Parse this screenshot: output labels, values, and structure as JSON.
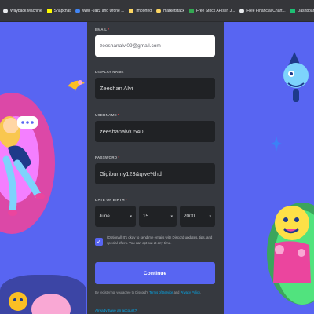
{
  "bookmarks": [
    {
      "label": "Wayback Machine",
      "color": "#e8eaed"
    },
    {
      "label": "Snapchat",
      "color": "#fffc00"
    },
    {
      "label": "Web -Jazz and Ufone ...",
      "color": "#4285f4"
    },
    {
      "label": "Imported",
      "color": "#fdd663"
    },
    {
      "label": "marketstack",
      "color": "#fdd663"
    },
    {
      "label": "Free Stock APIs in J...",
      "color": "#34a853"
    },
    {
      "label": "Free Financial Chart...",
      "color": "#e8eaed"
    },
    {
      "label": "Dashboard | Fiverr K...",
      "color": "#1dbf73"
    }
  ],
  "form": {
    "email": {
      "label": "EMAIL",
      "required": "*",
      "value": "zeeshanalvi09@gmail.com"
    },
    "display_name": {
      "label": "DISPLAY NAME",
      "value": "Zeeshan Alvi"
    },
    "username": {
      "label": "USERNAME",
      "required": "*",
      "value": "zeeshanalvi0540"
    },
    "password": {
      "label": "PASSWORD",
      "required": "*",
      "value": "Gigibunny123&qwe%hd"
    },
    "dob": {
      "label": "DATE OF BIRTH",
      "required": "*",
      "month": "June",
      "day": "15",
      "year": "2000"
    },
    "optional_text": "(Optional) It's okay to send me emails with Discord updates, tips, and special offers. You can opt out at any time.",
    "optional_checked": true,
    "continue_label": "Continue",
    "terms_prefix": "By registering, you agree to Discord's ",
    "terms_link": "Terms of Service",
    "terms_mid": " and ",
    "privacy_link": "Privacy Policy",
    "terms_suffix": ".",
    "already_label": "Already have an account?"
  },
  "colors": {
    "brand": "#5865f2",
    "card": "#36393f",
    "input": "#202225",
    "link": "#00aff4",
    "required": "#ed4245"
  }
}
